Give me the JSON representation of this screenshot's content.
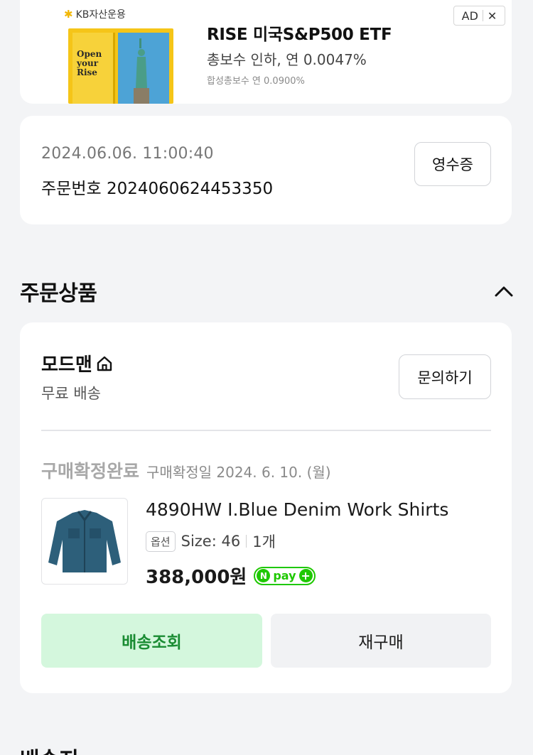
{
  "ad": {
    "brand": "KB자산운용",
    "door_text": "Open your Rise",
    "title": "RISE 미국S&P500 ETF",
    "subtitle": "총보수 인하, 연 0.0047%",
    "fine_print": "합성총보수 연 0.0900%",
    "badge": "AD",
    "close_glyph": "✕",
    "icons": [
      "kb-logo-icon",
      "statue-of-liberty-icon",
      "close-icon"
    ]
  },
  "order": {
    "datetime": "2024.06.06. 11:00:40",
    "number_label": "주문번호 2024060624453350",
    "receipt_label": "영수증"
  },
  "section": {
    "title": "주문상품",
    "next_title": "배송지"
  },
  "seller": {
    "name": "모드맨",
    "shipping": "무료 배송",
    "inquiry_label": "문의하기"
  },
  "item": {
    "status": "구매확정완료",
    "status_date": "구매확정일 2024. 6. 10. (월)",
    "name": "4890HW I.Blue Denim Work Shirts",
    "option_tag": "옵션",
    "size": "Size: 46",
    "quantity": "1개",
    "price": "388,000원",
    "npay_n": "N",
    "npay_text": "pay",
    "npay_plus": "+"
  },
  "actions": {
    "track_label": "배송조회",
    "rebuy_label": "재구매"
  },
  "colors": {
    "background": "#f3f4f6",
    "card": "#ffffff",
    "accent_green": "#1a8c33",
    "track_button_bg": "#d4f7dd",
    "npay_green": "#1ec800",
    "ad_yellow": "#f5c518"
  }
}
